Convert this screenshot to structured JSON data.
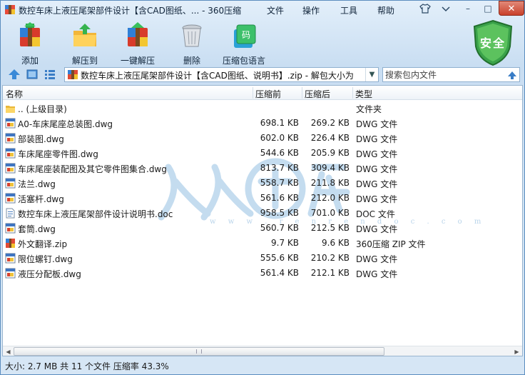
{
  "window": {
    "title": "数控车床上液压尾架部件设计【含CAD图纸、... - 360压缩",
    "menu": [
      "文件",
      "操作",
      "工具",
      "帮助"
    ],
    "controls": {
      "minimize": "–",
      "maximize": "□",
      "close": "✕"
    }
  },
  "toolbar": {
    "buttons": [
      {
        "label": "添加",
        "icon": "add-archive-icon"
      },
      {
        "label": "解压到",
        "icon": "extract-to-icon"
      },
      {
        "label": "一键解压",
        "icon": "one-click-extract-icon"
      },
      {
        "label": "删除",
        "icon": "delete-trash-icon"
      },
      {
        "label": "压缩包语言",
        "icon": "archive-language-icon"
      }
    ],
    "security_badge": "安全"
  },
  "address": {
    "path": "数控车床上液压尾架部件设计【含CAD图纸、说明书】.zip - 解包大小为",
    "search_placeholder": "搜索包内文件"
  },
  "columns": {
    "name": "名称",
    "original": "压缩前",
    "compressed": "压缩后",
    "type": "类型"
  },
  "files": [
    {
      "name": ".. (上级目录)",
      "original": "",
      "compressed": "",
      "type": "文件夹",
      "icon": "folder-icon"
    },
    {
      "name": "A0-车床尾座总装图.dwg",
      "original": "698.1 KB",
      "compressed": "269.2 KB",
      "type": "DWG 文件",
      "icon": "dwg-file-icon"
    },
    {
      "name": "部装图.dwg",
      "original": "602.0 KB",
      "compressed": "226.4 KB",
      "type": "DWG 文件",
      "icon": "dwg-file-icon"
    },
    {
      "name": "车床尾座零件图.dwg",
      "original": "544.6 KB",
      "compressed": "205.9 KB",
      "type": "DWG 文件",
      "icon": "dwg-file-icon"
    },
    {
      "name": "车床尾座装配图及其它零件图集合.dwg",
      "original": "813.7 KB",
      "compressed": "309.4 KB",
      "type": "DWG 文件",
      "icon": "dwg-file-icon"
    },
    {
      "name": "法兰.dwg",
      "original": "558.7 KB",
      "compressed": "211.8 KB",
      "type": "DWG 文件",
      "icon": "dwg-file-icon"
    },
    {
      "name": "活塞杆.dwg",
      "original": "561.6 KB",
      "compressed": "212.0 KB",
      "type": "DWG 文件",
      "icon": "dwg-file-icon"
    },
    {
      "name": "数控车床上液压尾架部件设计说明书.doc",
      "original": "958.5 KB",
      "compressed": "701.0 KB",
      "type": "DOC 文件",
      "icon": "doc-file-icon"
    },
    {
      "name": "套筒.dwg",
      "original": "560.7 KB",
      "compressed": "212.5 KB",
      "type": "DWG 文件",
      "icon": "dwg-file-icon"
    },
    {
      "name": "外文翻译.zip",
      "original": "9.7 KB",
      "compressed": "9.6 KB",
      "type": "360压缩 ZIP 文件",
      "icon": "zip-file-icon"
    },
    {
      "name": "限位螺钉.dwg",
      "original": "555.6 KB",
      "compressed": "210.2 KB",
      "type": "DWG 文件",
      "icon": "dwg-file-icon"
    },
    {
      "name": "液压分配板.dwg",
      "original": "561.4 KB",
      "compressed": "212.1 KB",
      "type": "DWG 文件",
      "icon": "dwg-file-icon"
    }
  ],
  "watermark": {
    "text": "w w w . r e n r e n d o c . c o m"
  },
  "status": "大小: 2.7 MB 共 11 个文件 压缩率 43.3%"
}
